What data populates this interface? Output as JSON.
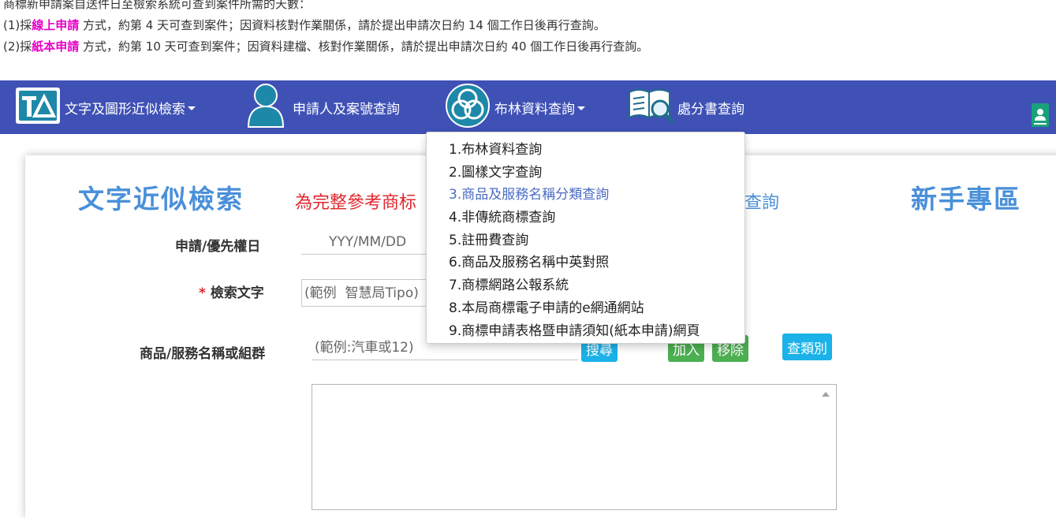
{
  "notice": {
    "line0": "商標新申請案自送件日至檢索系統可查到案件所需的天數：",
    "line1_prefix": "(1)採",
    "line1_hl": "線上申請",
    "line1_suffix": " 方式，約第 4 天可查到案件；因資料核對作業關係，請於提出申請次日約 14 個工作日後再行查詢。",
    "line2_prefix": "(2)採",
    "line2_hl": "紙本申請",
    "line2_suffix": " 方式，約第 10 天可查到案件；因資料建檔、核對作業關係，請於提出申請次日約 40 個工作日後再行查詢。"
  },
  "nav": {
    "item1": "文字及圖形近似檢索",
    "item2": "申請人及案號查詢",
    "item3": "布林資料查詢",
    "item4": "處分書查詢"
  },
  "dropdown": {
    "items": [
      "1.布林資料查詢",
      "2.圖樣文字查詢",
      "3.商品及服務名稱分類查詢",
      "4.非傳統商標查詢",
      "5.註冊費查詢",
      "6.商品及服務名稱中英對照",
      "7.商標網路公報系統",
      "8.本局商標電子申請的e網通網站",
      "9.商標申請表格暨申請須知(紙本申請)網頁"
    ]
  },
  "main": {
    "title": "文字近似檢索",
    "notice_red": "為完整參考商标",
    "notice_tail": "查詢",
    "newbie": "新手專區",
    "date_label": "申請/優先權日",
    "date_placeholder": "YYY/MM/DD",
    "search_label": "檢索文字",
    "search_required": "*",
    "search_placeholder": "(範例  智慧局Tipo)",
    "goods_label": "商品/服務名稱或組群",
    "goods_placeholder": "(範例:汽車或12)",
    "btn_search": "搜尋",
    "btn_add": "加入",
    "btn_remove": "移除",
    "btn_classes": "查類別"
  },
  "colors": {
    "nav_bg": "#3f51b5",
    "highlight": "#e600c8",
    "title_blue": "#4a90d9",
    "notice_red": "#e0262d"
  }
}
